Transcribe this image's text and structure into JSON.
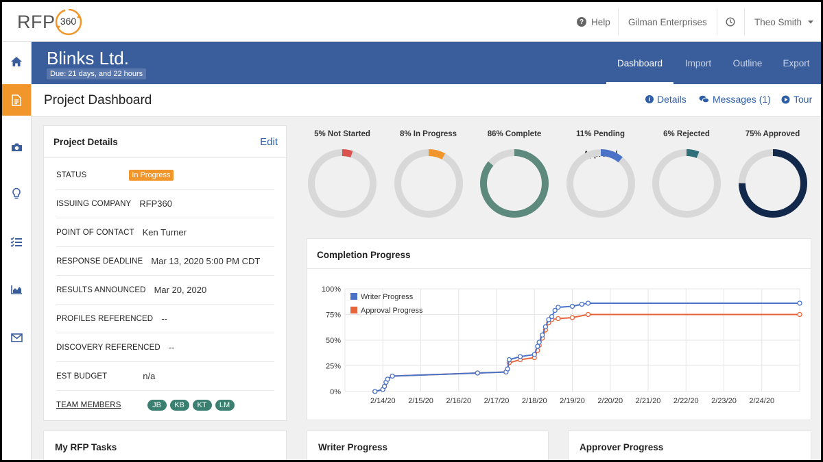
{
  "logo": {
    "text": "RFP",
    "number": "360"
  },
  "topbar": {
    "help_label": "Help",
    "org_name": "Gilman Enterprises",
    "user_name": "Theo Smith"
  },
  "header": {
    "company": "Blinks Ltd.",
    "due": "Due: 21 days, and 22 hours",
    "tabs": [
      {
        "label": "Dashboard",
        "active": true
      },
      {
        "label": "Import",
        "active": false
      },
      {
        "label": "Outline",
        "active": false
      },
      {
        "label": "Export",
        "active": false
      }
    ]
  },
  "sidebar": {
    "items": [
      {
        "icon": "home-icon",
        "active": false
      },
      {
        "icon": "document-icon",
        "active": true
      },
      {
        "icon": "camera-icon",
        "active": false
      },
      {
        "icon": "lightbulb-icon",
        "active": false
      },
      {
        "icon": "checklist-icon",
        "active": false
      },
      {
        "icon": "area-chart-icon",
        "active": false
      },
      {
        "icon": "envelope-icon",
        "active": false
      }
    ]
  },
  "subheader": {
    "title": "Project Dashboard",
    "details_label": "Details",
    "messages_label": "Messages (1)",
    "tour_label": "Tour"
  },
  "project_details": {
    "title": "Project Details",
    "edit_label": "Edit",
    "rows": [
      {
        "label": "STATUS",
        "value": "In Progress"
      },
      {
        "label": "ISSUING COMPANY",
        "value": "RFP360"
      },
      {
        "label": "POINT OF CONTACT",
        "value": "Ken Turner"
      },
      {
        "label": "RESPONSE DEADLINE",
        "value": "Mar 13, 2020 5:00 PM CDT"
      },
      {
        "label": "RESULTS ANNOUNCED",
        "value": "Mar 20, 2020"
      },
      {
        "label": "PROFILES REFERENCED",
        "value": "--"
      },
      {
        "label": "DISCOVERY REFERENCED",
        "value": "--"
      },
      {
        "label": "EST BUDGET",
        "value": "n/a"
      },
      {
        "label": "TEAM MEMBERS",
        "value": ""
      }
    ],
    "team_members": [
      "JB",
      "KB",
      "KT",
      "LM"
    ]
  },
  "donuts": [
    {
      "label": "5% Not Started",
      "percent": 5,
      "color": "#d9534f"
    },
    {
      "label": "8% In Progress",
      "percent": 8,
      "color": "#f0962a"
    },
    {
      "label": "86% Complete",
      "percent": 86,
      "color": "#5e8a7e"
    },
    {
      "label": "11% Pending Approval",
      "percent": 11,
      "color": "#4a73c7"
    },
    {
      "label": "6% Rejected",
      "percent": 6,
      "color": "#2e6f7a"
    },
    {
      "label": "75% Approved",
      "percent": 75,
      "color": "#13294b"
    }
  ],
  "completion_chart": {
    "title": "Completion Progress",
    "chart_data": {
      "type": "line",
      "x_ticks": [
        "2/14/20",
        "2/15/20",
        "2/16/20",
        "2/17/20",
        "2/18/20",
        "2/19/20",
        "2/20/20",
        "2/21/20",
        "2/22/20",
        "2/23/20",
        "2/24/20"
      ],
      "y_ticks": [
        "0%",
        "25%",
        "50%",
        "75%",
        "100%"
      ],
      "ylim": [
        0,
        100
      ],
      "xlim": [
        "2/13/20",
        "2/25/20"
      ],
      "grid": true,
      "legend_position": "top-left",
      "series": [
        {
          "name": "Writer Progress",
          "color": "#4a73c7",
          "points": [
            [
              "2/13/20 19:00",
              0
            ],
            [
              "2/14/20 00:00",
              2
            ],
            [
              "2/14/20 01:00",
              5
            ],
            [
              "2/14/20 02:00",
              9
            ],
            [
              "2/14/20 03:00",
              12
            ],
            [
              "2/14/20 06:00",
              15
            ],
            [
              "2/16/20 12:00",
              18
            ],
            [
              "2/17/20 06:00",
              19
            ],
            [
              "2/17/20 07:00",
              22
            ],
            [
              "2/17/20 08:00",
              31
            ],
            [
              "2/17/20 15:00",
              34
            ],
            [
              "2/18/20 00:00",
              36
            ],
            [
              "2/18/20 02:00",
              44
            ],
            [
              "2/18/20 03:00",
              48
            ],
            [
              "2/18/20 05:00",
              55
            ],
            [
              "2/18/20 07:00",
              63
            ],
            [
              "2/18/20 09:00",
              70
            ],
            [
              "2/18/20 11:00",
              73
            ],
            [
              "2/18/20 13:00",
              79
            ],
            [
              "2/18/20 15:00",
              82
            ],
            [
              "2/19/20 00:00",
              83
            ],
            [
              "2/19/20 06:00",
              85
            ],
            [
              "2/19/20 10:00",
              86
            ],
            [
              "2/25/20 00:00",
              86
            ]
          ]
        },
        {
          "name": "Approval Progress",
          "color": "#e8643a",
          "points": [
            [
              "2/13/20 19:00",
              0
            ],
            [
              "2/14/20 00:00",
              2
            ],
            [
              "2/14/20 01:00",
              5
            ],
            [
              "2/14/20 02:00",
              9
            ],
            [
              "2/14/20 03:00",
              12
            ],
            [
              "2/14/20 06:00",
              15
            ],
            [
              "2/16/20 12:00",
              18
            ],
            [
              "2/17/20 06:00",
              19
            ],
            [
              "2/17/20 07:00",
              22
            ],
            [
              "2/17/20 08:00",
              28
            ],
            [
              "2/17/20 15:00",
              31
            ],
            [
              "2/18/20 00:00",
              33
            ],
            [
              "2/18/20 02:00",
              40
            ],
            [
              "2/18/20 03:00",
              45
            ],
            [
              "2/18/20 05:00",
              52
            ],
            [
              "2/18/20 07:00",
              60
            ],
            [
              "2/18/20 09:00",
              67
            ],
            [
              "2/18/20 11:00",
              70
            ],
            [
              "2/18/20 15:00",
              71
            ],
            [
              "2/19/20 00:00",
              72
            ],
            [
              "2/19/20 10:00",
              75
            ],
            [
              "2/25/20 00:00",
              75
            ]
          ]
        }
      ]
    }
  },
  "bottom_cards": {
    "tasks_title": "My RFP Tasks",
    "writer_title": "Writer Progress",
    "approver_title": "Approver Progress"
  }
}
